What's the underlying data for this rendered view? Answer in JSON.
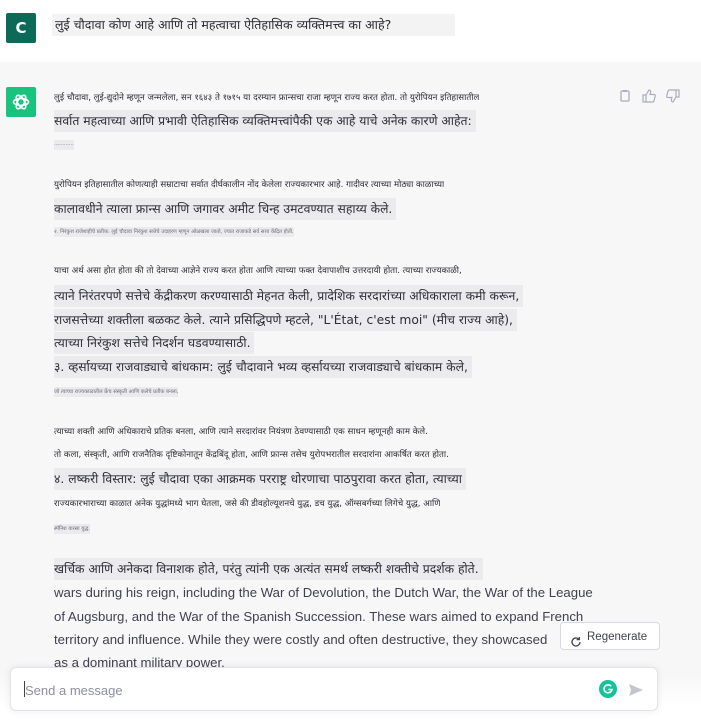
{
  "user_message": {
    "avatar_letter": "C",
    "text": "लुई चौदावा कोण आहे आणि तो महत्वाचा ऐतिहासिक व्यक्तिमत्त्व का आहे?"
  },
  "assistant_message": {
    "lines": [
      "लुई चौदावा, लुई-द्युदोने म्हणून जन्मलेला, सन १६४३ ते १७१५ या दरम्यान फ्रान्सचा राजा म्हणून राज्य करत होता. तो युरोपियन इतिहासातील",
      "सर्वात महत्वाच्या आणि प्रभावी ऐतिहासिक व्यक्तिमत्त्वांपैकी एक आहे याचे अनेक कारणे आहेत:",
      "············",
      "युरोपियन इतिहासातील कोणत्याही सम्राटाचा सर्वात दीर्घकालीन नोंद केलेला राज्यकारभार आहे. गादीवर त्याच्या मोठ्या काळाच्या",
      "कालावधीने त्याला फ्रान्स आणि जगावर अमीट चिन्ह उमटवण्यात सहाय्य केले.",
      "२. निरंकुश राजेशाहीचे प्रतीक: लुई चौदावा निरंकुश सत्तेचे उदाहरण म्हणून ओळखला जातो, ज्यात राजाकडे सर्व सत्ता केंद्रित होती.",
      "याचा अर्थ असा होत होता की तो देवाच्या आज्ञेने राज्य करत होता आणि त्याच्या फक्त देवापाशीच उत्तरदायी होता. त्याच्या राज्यकाळी,",
      "त्याने निरंतरपणे सत्तेचे केंद्रीकरण करण्यासाठी मेहनत केली, प्रादेशिक सरदारांच्या अधिकाराला कमी करून,",
      "राजसत्तेच्या शक्तीला बळकट केले. त्याने प्रसिद्धिपणे म्हटले, \"L'État, c'est moi\" (मीच राज्य आहे),",
      "त्याच्या निरंकुश सत्तेचे निदर्शन घडवण्यासाठी.",
      "३. व्हर्सायच्या राजवाड्याचे बांधकाम: लुई चौदावाने भव्य व्हर्सायच्या राजवाड्याचे बांधकाम केले,",
      "जो त्याच्या राज्यकाळातील फ्रेंच संस्कृती आणि कलेचे प्रतीक बनला,",
      "त्याच्या शक्ती आणि अधिकाराचे प्रतिक बनला, आणि त्याने सरदारांवर नियंत्रण ठेवण्यासाठी एक साधन म्हणूनही काम केले.",
      "तो कला, संस्कृती, आणि राजनैतिक दृष्टिकोनातून केंद्रबिंदू होता, आणि फ्रान्स तसेच युरोपभरातील सरदारांना आकर्षित करत होता.",
      "४. लष्करी विस्तार: लुई चौदावा एका आक्रमक परराष्ट्र धोरणाचा पाठपुरावा करत होता, त्याच्या",
      "राज्यकारभाराच्या काळात अनेक युद्धांमध्ये भाग घेतला, जसे की डीवहोल्यूशनचे युद्ध, डच युद्ध, ऑग्सबर्गच्या लिगेचे युद्ध, आणि",
      "स्पॅनिश वारसा युद्ध.",
      "खर्चिक आणि अनेकदा विनाशक होते, परंतु त्यांनी एक अत्यंत समर्थ लष्करी शक्तीचे प्रदर्शक होते.",
      "wars during his reign, including the War of Devolution, the Dutch War, the War of the League",
      "of Augsburg, and the War of the Spanish Succession. These wars aimed to expand French",
      "territory and influence. While they were costly and often destructive, they showcased",
      "as a dominant military power."
    ]
  },
  "regenerate": {
    "label": "Regenerate",
    "icon": "refresh-icon"
  },
  "composer": {
    "placeholder": "Send a message"
  },
  "colors": {
    "brand": "#19c37d",
    "user_avatar": "#0b6b58",
    "grammarly": "#15c39a"
  }
}
